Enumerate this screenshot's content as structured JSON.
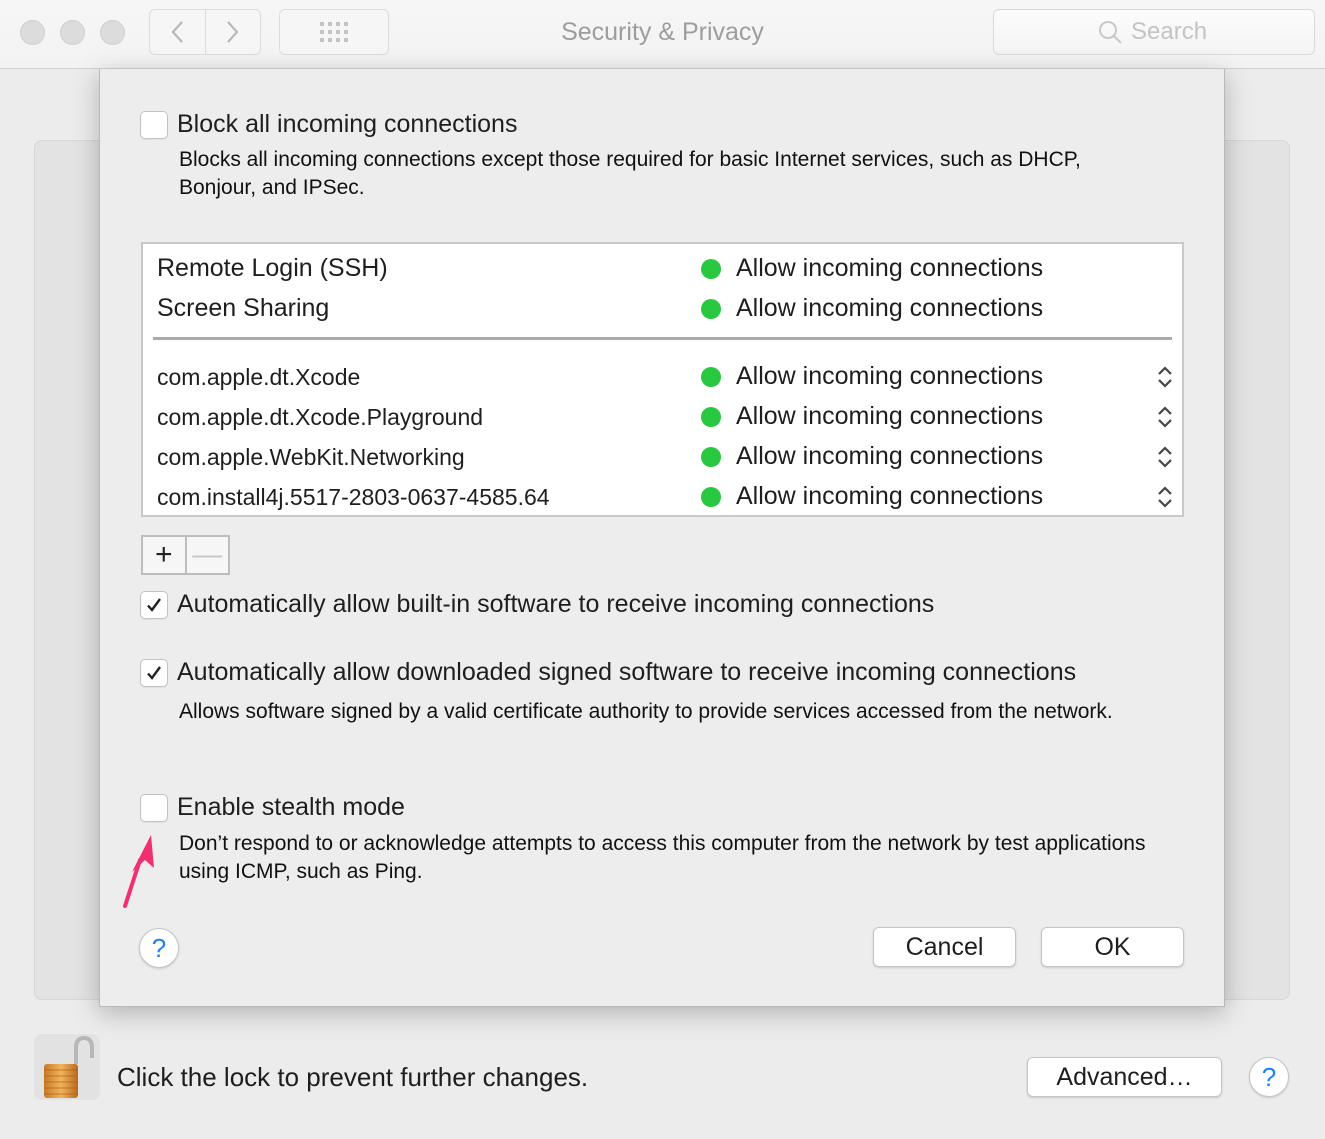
{
  "window": {
    "title": "Security & Privacy",
    "search_placeholder": "Search",
    "icons": {
      "back": "chevron-left-icon",
      "forward": "chevron-right-icon",
      "show_all": "grid-icon",
      "search": "magnifier-icon"
    }
  },
  "sheet": {
    "block_all": {
      "label": "Block all incoming connections",
      "checked": false,
      "description": "Blocks all incoming connections except those required for basic Internet services, such as DHCP, Bonjour, and IPSec."
    },
    "services": [
      {
        "name": "Remote Login (SSH)",
        "status": "Allow incoming connections",
        "status_color": "#28c840"
      },
      {
        "name": "Screen Sharing",
        "status": "Allow incoming connections",
        "status_color": "#28c840"
      }
    ],
    "apps": [
      {
        "name": "com.apple.dt.Xcode",
        "status": "Allow incoming connections",
        "status_color": "#28c840"
      },
      {
        "name": "com.apple.dt.Xcode.Playground",
        "status": "Allow incoming connections",
        "status_color": "#28c840"
      },
      {
        "name": "com.apple.WebKit.Networking",
        "status": "Allow incoming connections",
        "status_color": "#28c840"
      },
      {
        "name": "com.install4j.5517-2803-0637-4585.64",
        "status": "Allow incoming connections",
        "status_color": "#28c840"
      }
    ],
    "add_label": "+",
    "remove_label": "—",
    "auto_builtin": {
      "label": "Automatically allow built-in software to receive incoming connections",
      "checked": true
    },
    "auto_signed": {
      "label": "Automatically allow downloaded signed software to receive incoming connections",
      "checked": true,
      "description": "Allows software signed by a valid certificate authority to provide services accessed from the network."
    },
    "stealth": {
      "label": "Enable stealth mode",
      "checked": false,
      "description": "Don’t respond to or acknowledge attempts to access this computer from the network by test applications using ICMP, such as Ping."
    },
    "help_label": "?",
    "cancel_label": "Cancel",
    "ok_label": "OK",
    "annotation_color": "#f0306f"
  },
  "footer": {
    "lock_text": "Click the lock to prevent further changes.",
    "advanced_label": "Advanced…",
    "help_label": "?"
  }
}
